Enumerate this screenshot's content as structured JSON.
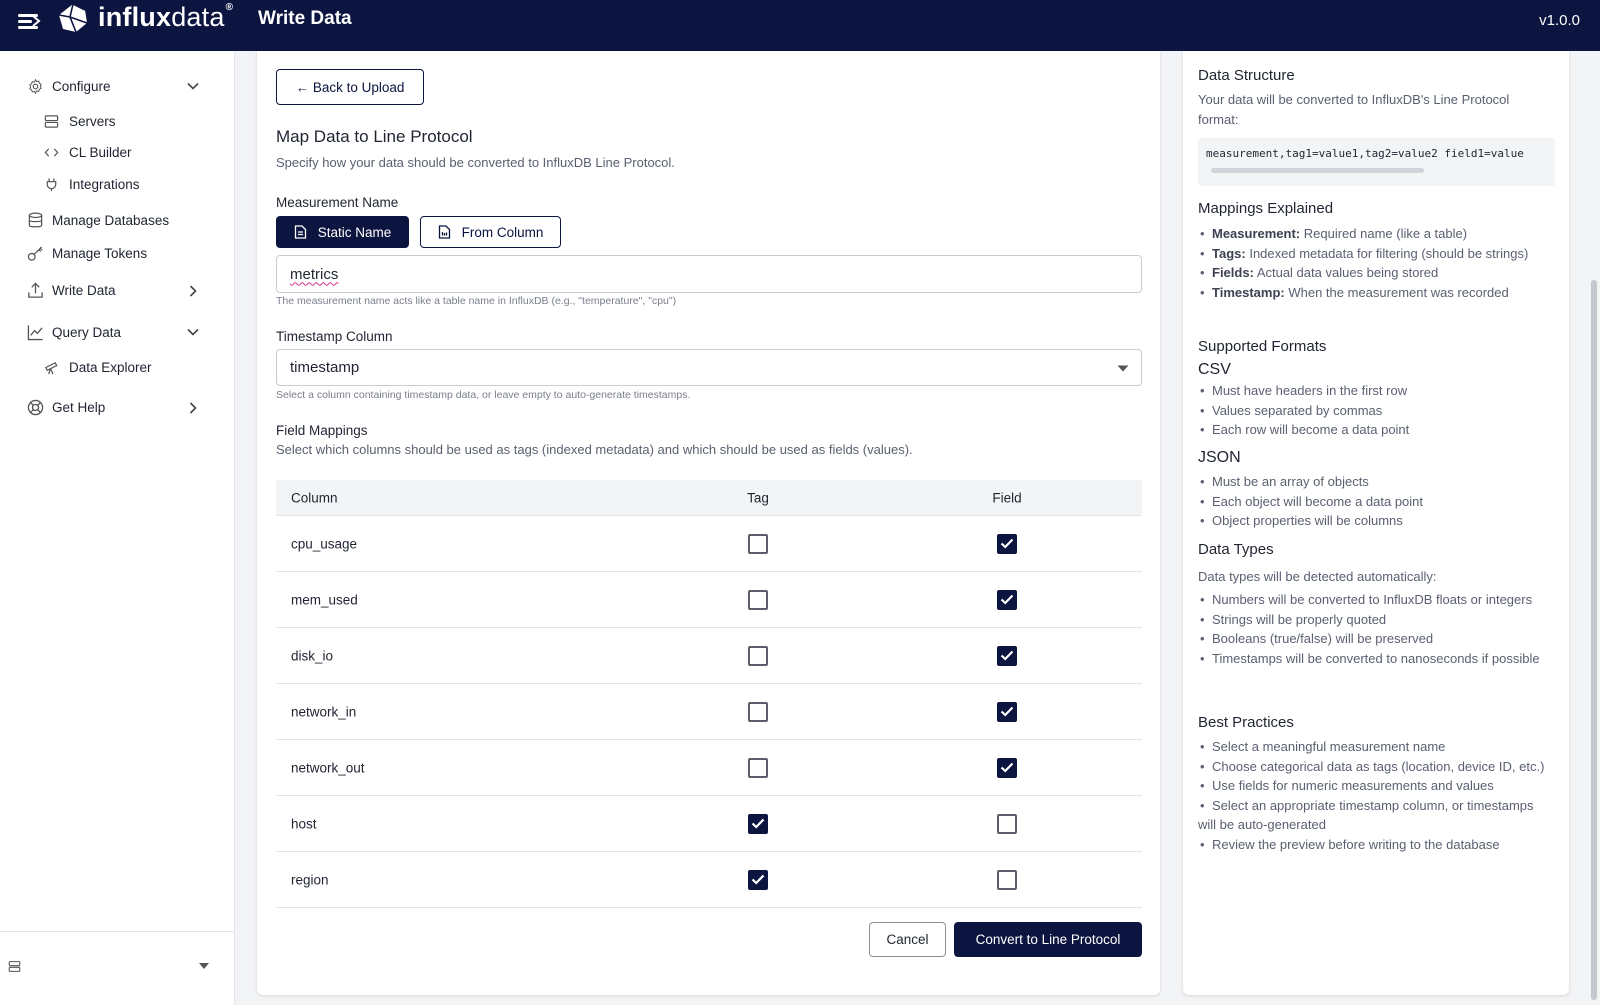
{
  "header": {
    "logo_bold": "influx",
    "logo_thin": "data",
    "logo_reg": "®",
    "title": "Write Data",
    "version": "v1.0.0"
  },
  "sidebar": {
    "items": [
      {
        "label": "Configure",
        "icon": "gear-icon",
        "chevron": "down"
      },
      {
        "label": "Servers",
        "icon": "server-icon"
      },
      {
        "label": "CL Builder",
        "icon": "code-icon"
      },
      {
        "label": "Integrations",
        "icon": "plug-icon"
      },
      {
        "label": "Manage Databases",
        "icon": "database-icon"
      },
      {
        "label": "Manage Tokens",
        "icon": "key-icon"
      },
      {
        "label": "Write Data",
        "icon": "upload-icon",
        "chevron": "right"
      },
      {
        "label": "Query Data",
        "icon": "chart-icon",
        "chevron": "down"
      },
      {
        "label": "Data Explorer",
        "icon": "telescope-icon"
      },
      {
        "label": "Get Help",
        "icon": "lifebuoy-icon",
        "chevron": "right"
      }
    ]
  },
  "main": {
    "back_label": "← Back to Upload",
    "title": "Map Data to Line Protocol",
    "subtitle": "Specify how your data should be converted to InfluxDB Line Protocol.",
    "measurement": {
      "label": "Measurement Name",
      "static_label": "Static Name",
      "from_column_label": "From Column",
      "value": "metrics",
      "help": "The measurement name acts like a table name in InfluxDB (e.g., \"temperature\", \"cpu\")"
    },
    "timestamp": {
      "label": "Timestamp Column",
      "value": "timestamp",
      "help": "Select a column containing timestamp data, or leave empty to auto-generate timestamps."
    },
    "field_mappings": {
      "label": "Field Mappings",
      "help": "Select which columns should be used as tags (indexed metadata) and which should be used as fields (values).",
      "headers": {
        "column": "Column",
        "tag": "Tag",
        "field": "Field"
      },
      "rows": [
        {
          "column": "cpu_usage",
          "tag": false,
          "field": true
        },
        {
          "column": "mem_used",
          "tag": false,
          "field": true
        },
        {
          "column": "disk_io",
          "tag": false,
          "field": true
        },
        {
          "column": "network_in",
          "tag": false,
          "field": true
        },
        {
          "column": "network_out",
          "tag": false,
          "field": true
        },
        {
          "column": "host",
          "tag": true,
          "field": false
        },
        {
          "column": "region",
          "tag": true,
          "field": false
        }
      ]
    },
    "cancel_label": "Cancel",
    "convert_label": "Convert to Line Protocol"
  },
  "panel": {
    "data_structure": {
      "title": "Data Structure",
      "text": "Your data will be converted to InfluxDB's Line Protocol format:",
      "code": "measurement,tag1=value1,tag2=value2 field1=value"
    },
    "mappings": {
      "title": "Mappings Explained",
      "items": [
        {
          "term": "Measurement:",
          "desc": "Required name (like a table)"
        },
        {
          "term": "Tags:",
          "desc": "Indexed metadata for filtering (should be strings)"
        },
        {
          "term": "Fields:",
          "desc": "Actual data values being stored"
        },
        {
          "term": "Timestamp:",
          "desc": "When the measurement was recorded"
        }
      ]
    },
    "formats": {
      "title": "Supported Formats",
      "csv_title": "CSV",
      "csv_items": [
        "Must have headers in the first row",
        "Values separated by commas",
        "Each row will become a data point"
      ],
      "json_title": "JSON",
      "json_items": [
        "Must be an array of objects",
        "Each object will become a data point",
        "Object properties will be columns"
      ]
    },
    "types": {
      "title": "Data Types",
      "intro": "Data types will be detected automatically:",
      "items": [
        "Numbers will be converted to InfluxDB floats or integers",
        "Strings will be properly quoted",
        "Booleans (true/false) will be preserved",
        "Timestamps will be converted to nanoseconds if possible"
      ]
    },
    "practices": {
      "title": "Best Practices",
      "items": [
        "Select a meaningful measurement name",
        "Choose categorical data as tags (location, device ID, etc.)",
        "Use fields for numeric measurements and values",
        "Select an appropriate timestamp column, or timestamps will be auto-generated",
        "Review the preview before writing to the database"
      ]
    }
  }
}
